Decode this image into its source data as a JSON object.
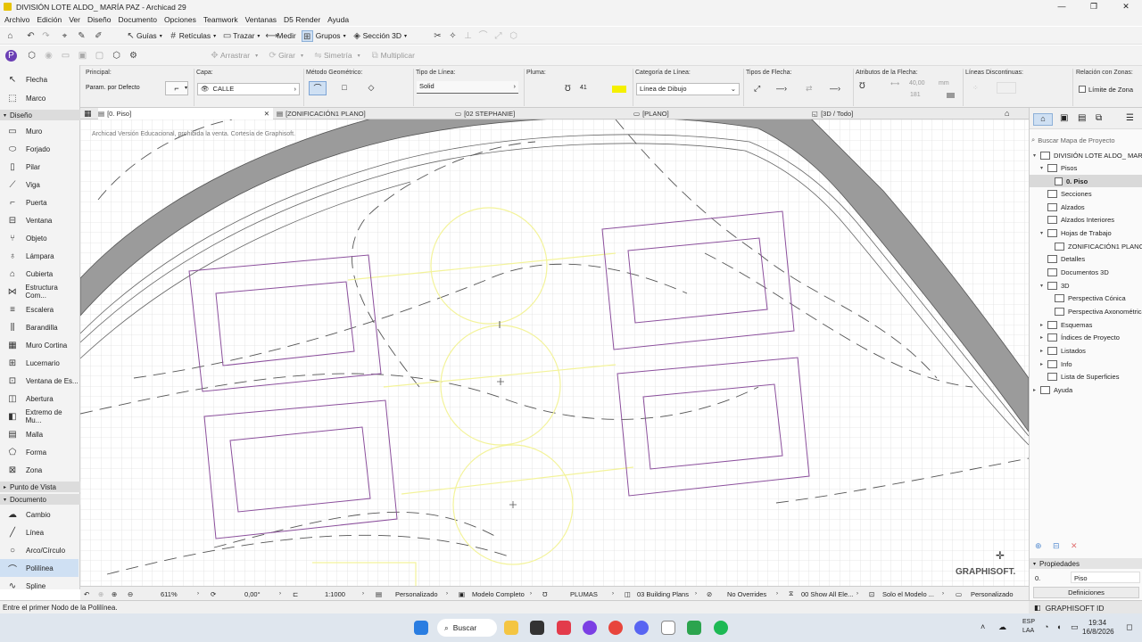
{
  "window": {
    "title": "DIVISIÓN LOTE ALDO_ MARÍA PAZ - Archicad 29",
    "controls": [
      "—",
      "❐",
      "✕"
    ]
  },
  "menu": [
    "Archivo",
    "Edición",
    "Ver",
    "Diseño",
    "Documento",
    "Opciones",
    "Teamwork",
    "Ventanas",
    "D5 Render",
    "Ayuda"
  ],
  "toolbar1": {
    "guides": "Guías",
    "grids": "Retículas",
    "trace": "Trazar",
    "measure": "Medir",
    "groups": "Grupos",
    "section3d": "Sección 3D"
  },
  "toolbar2": {
    "drag": "Arrastrar",
    "rotate": "Girar",
    "mirror": "Simetría",
    "multiply": "Multiplicar"
  },
  "infobox": {
    "principal_label": "Principal:",
    "principal_value": "Param. por Defecto",
    "layer_label": "Capa:",
    "layer_value": "CALLE",
    "geometry_label": "Método Geométrico:",
    "linetype_label": "Tipo de Línea:",
    "linetype_value": "Solid",
    "pen_label": "Pluma:",
    "pen_value": "41",
    "pen_color": "#f5f000",
    "linecat_label": "Categoría de Línea:",
    "linecat_value": "Línea de Dibujo",
    "arrow_label": "Tipos de Flecha:",
    "arrowattr_label": "Atributos de la Flecha:",
    "arrow_size": "40,00",
    "arrow_unit": "mm",
    "arrow_pen": "181",
    "dashed_label": "Líneas Discontinuas:",
    "zone_label": "Relación con Zonas:",
    "zone_checkbox": "Límite de Zona"
  },
  "toolbox": {
    "top": [
      {
        "label": "Flecha",
        "icon": "arrow-icon"
      },
      {
        "label": "Marco",
        "icon": "marquee-icon"
      }
    ],
    "design_section": "Diseño",
    "design": [
      {
        "label": "Muro"
      },
      {
        "label": "Forjado"
      },
      {
        "label": "Pilar"
      },
      {
        "label": "Viga"
      },
      {
        "label": "Puerta"
      },
      {
        "label": "Ventana"
      },
      {
        "label": "Objeto"
      },
      {
        "label": "Lámpara"
      },
      {
        "label": "Cubierta"
      },
      {
        "label": "Estructura Com..."
      },
      {
        "label": "Escalera"
      },
      {
        "label": "Barandilla"
      },
      {
        "label": "Muro Cortina"
      },
      {
        "label": "Lucernario"
      },
      {
        "label": "Ventana de Es..."
      },
      {
        "label": "Abertura"
      },
      {
        "label": "Extremo de Mu..."
      },
      {
        "label": "Malla"
      },
      {
        "label": "Forma"
      },
      {
        "label": "Zona"
      }
    ],
    "viewpoint_section": "Punto de Vista",
    "document_section": "Documento",
    "document": [
      {
        "label": "Cambio"
      },
      {
        "label": "Línea"
      },
      {
        "label": "Arco/Círculo"
      },
      {
        "label": "Polilínea",
        "selected": true
      },
      {
        "label": "Spline"
      }
    ]
  },
  "tabs": [
    {
      "label": "[0. Piso]",
      "active": true
    },
    {
      "label": "[ZONIFICACIÓN1 PLANO]"
    },
    {
      "label": "[02 STEPHANIE]"
    },
    {
      "label": "[PLANO]"
    },
    {
      "label": "[3D / Todo]"
    }
  ],
  "canvas": {
    "watermark": "Archicad Versión Educacional, prohibida la venta. Cortesía de Graphisoft.",
    "brand": "GRAPHISOFT."
  },
  "viewbar": {
    "zoom": "611%",
    "angle": "0,00°",
    "scale": "1:1000",
    "structure": "Personalizado",
    "model": "Modelo Completo",
    "pens": "PLUMAS",
    "layers": "03 Building Plans",
    "overrides": "No Overrides",
    "renovation": "00 Show All Ele...",
    "dims": "Solo el Modelo ...",
    "custom": "Personalizado"
  },
  "navigator": {
    "search_placeholder": "Buscar Mapa de Proyecto",
    "tree": [
      {
        "label": "DIVISIÓN LOTE ALDO_ MARÍA",
        "level": 0,
        "arrow": "▾"
      },
      {
        "label": "Pisos",
        "level": 1,
        "arrow": "▾"
      },
      {
        "label": "0. Piso",
        "level": 2,
        "arrow": "",
        "selected": true
      },
      {
        "label": "Secciones",
        "level": 1,
        "arrow": ""
      },
      {
        "label": "Alzados",
        "level": 1,
        "arrow": ""
      },
      {
        "label": "Alzados Interiores",
        "level": 1,
        "arrow": ""
      },
      {
        "label": "Hojas de Trabajo",
        "level": 1,
        "arrow": "▾"
      },
      {
        "label": "ZONIFICACIÓN1 PLANO (",
        "level": 2,
        "arrow": ""
      },
      {
        "label": "Detalles",
        "level": 1,
        "arrow": ""
      },
      {
        "label": "Documentos 3D",
        "level": 1,
        "arrow": ""
      },
      {
        "label": "3D",
        "level": 1,
        "arrow": "▾"
      },
      {
        "label": "Perspectiva Cónica",
        "level": 2,
        "arrow": ""
      },
      {
        "label": "Perspectiva Axonométrica",
        "level": 2,
        "arrow": ""
      },
      {
        "label": "Esquemas",
        "level": 1,
        "arrow": "▸"
      },
      {
        "label": "Índices de Proyecto",
        "level": 1,
        "arrow": "▸"
      },
      {
        "label": "Listados",
        "level": 1,
        "arrow": "▸"
      },
      {
        "label": "Info",
        "level": 1,
        "arrow": "▸"
      },
      {
        "label": "Lista de Superficies",
        "level": 1,
        "arrow": ""
      },
      {
        "label": "Ayuda",
        "level": 0,
        "arrow": "▸"
      }
    ],
    "properties_header": "Propiedades",
    "prop_id": "0.",
    "prop_name": "Piso",
    "prop_button": "Definiciones"
  },
  "status": {
    "message": "Entre el primer Nodo de la Polilínea.",
    "graphisoft_id": "GRAPHISOFT ID"
  },
  "taskbar": {
    "search": "Buscar",
    "lang1": "ESP",
    "lang2": "LAA",
    "time": "19:34",
    "date": "16/8/2026"
  }
}
